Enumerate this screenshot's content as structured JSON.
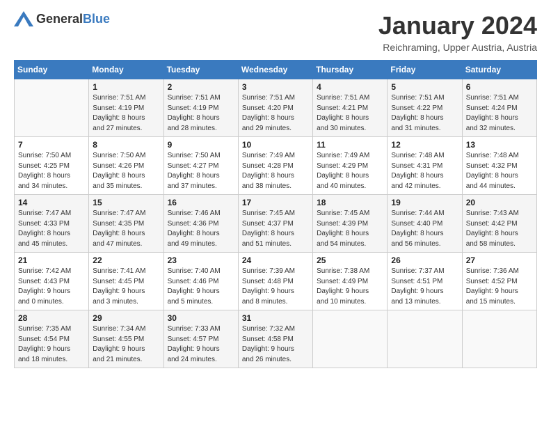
{
  "header": {
    "logo_general": "General",
    "logo_blue": "Blue",
    "month": "January 2024",
    "location": "Reichraming, Upper Austria, Austria"
  },
  "weekdays": [
    "Sunday",
    "Monday",
    "Tuesday",
    "Wednesday",
    "Thursday",
    "Friday",
    "Saturday"
  ],
  "weeks": [
    [
      {
        "day": "",
        "info": ""
      },
      {
        "day": "1",
        "info": "Sunrise: 7:51 AM\nSunset: 4:19 PM\nDaylight: 8 hours\nand 27 minutes."
      },
      {
        "day": "2",
        "info": "Sunrise: 7:51 AM\nSunset: 4:19 PM\nDaylight: 8 hours\nand 28 minutes."
      },
      {
        "day": "3",
        "info": "Sunrise: 7:51 AM\nSunset: 4:20 PM\nDaylight: 8 hours\nand 29 minutes."
      },
      {
        "day": "4",
        "info": "Sunrise: 7:51 AM\nSunset: 4:21 PM\nDaylight: 8 hours\nand 30 minutes."
      },
      {
        "day": "5",
        "info": "Sunrise: 7:51 AM\nSunset: 4:22 PM\nDaylight: 8 hours\nand 31 minutes."
      },
      {
        "day": "6",
        "info": "Sunrise: 7:51 AM\nSunset: 4:24 PM\nDaylight: 8 hours\nand 32 minutes."
      }
    ],
    [
      {
        "day": "7",
        "info": "Sunrise: 7:50 AM\nSunset: 4:25 PM\nDaylight: 8 hours\nand 34 minutes."
      },
      {
        "day": "8",
        "info": "Sunrise: 7:50 AM\nSunset: 4:26 PM\nDaylight: 8 hours\nand 35 minutes."
      },
      {
        "day": "9",
        "info": "Sunrise: 7:50 AM\nSunset: 4:27 PM\nDaylight: 8 hours\nand 37 minutes."
      },
      {
        "day": "10",
        "info": "Sunrise: 7:49 AM\nSunset: 4:28 PM\nDaylight: 8 hours\nand 38 minutes."
      },
      {
        "day": "11",
        "info": "Sunrise: 7:49 AM\nSunset: 4:29 PM\nDaylight: 8 hours\nand 40 minutes."
      },
      {
        "day": "12",
        "info": "Sunrise: 7:48 AM\nSunset: 4:31 PM\nDaylight: 8 hours\nand 42 minutes."
      },
      {
        "day": "13",
        "info": "Sunrise: 7:48 AM\nSunset: 4:32 PM\nDaylight: 8 hours\nand 44 minutes."
      }
    ],
    [
      {
        "day": "14",
        "info": "Sunrise: 7:47 AM\nSunset: 4:33 PM\nDaylight: 8 hours\nand 45 minutes."
      },
      {
        "day": "15",
        "info": "Sunrise: 7:47 AM\nSunset: 4:35 PM\nDaylight: 8 hours\nand 47 minutes."
      },
      {
        "day": "16",
        "info": "Sunrise: 7:46 AM\nSunset: 4:36 PM\nDaylight: 8 hours\nand 49 minutes."
      },
      {
        "day": "17",
        "info": "Sunrise: 7:45 AM\nSunset: 4:37 PM\nDaylight: 8 hours\nand 51 minutes."
      },
      {
        "day": "18",
        "info": "Sunrise: 7:45 AM\nSunset: 4:39 PM\nDaylight: 8 hours\nand 54 minutes."
      },
      {
        "day": "19",
        "info": "Sunrise: 7:44 AM\nSunset: 4:40 PM\nDaylight: 8 hours\nand 56 minutes."
      },
      {
        "day": "20",
        "info": "Sunrise: 7:43 AM\nSunset: 4:42 PM\nDaylight: 8 hours\nand 58 minutes."
      }
    ],
    [
      {
        "day": "21",
        "info": "Sunrise: 7:42 AM\nSunset: 4:43 PM\nDaylight: 9 hours\nand 0 minutes."
      },
      {
        "day": "22",
        "info": "Sunrise: 7:41 AM\nSunset: 4:45 PM\nDaylight: 9 hours\nand 3 minutes."
      },
      {
        "day": "23",
        "info": "Sunrise: 7:40 AM\nSunset: 4:46 PM\nDaylight: 9 hours\nand 5 minutes."
      },
      {
        "day": "24",
        "info": "Sunrise: 7:39 AM\nSunset: 4:48 PM\nDaylight: 9 hours\nand 8 minutes."
      },
      {
        "day": "25",
        "info": "Sunrise: 7:38 AM\nSunset: 4:49 PM\nDaylight: 9 hours\nand 10 minutes."
      },
      {
        "day": "26",
        "info": "Sunrise: 7:37 AM\nSunset: 4:51 PM\nDaylight: 9 hours\nand 13 minutes."
      },
      {
        "day": "27",
        "info": "Sunrise: 7:36 AM\nSunset: 4:52 PM\nDaylight: 9 hours\nand 15 minutes."
      }
    ],
    [
      {
        "day": "28",
        "info": "Sunrise: 7:35 AM\nSunset: 4:54 PM\nDaylight: 9 hours\nand 18 minutes."
      },
      {
        "day": "29",
        "info": "Sunrise: 7:34 AM\nSunset: 4:55 PM\nDaylight: 9 hours\nand 21 minutes."
      },
      {
        "day": "30",
        "info": "Sunrise: 7:33 AM\nSunset: 4:57 PM\nDaylight: 9 hours\nand 24 minutes."
      },
      {
        "day": "31",
        "info": "Sunrise: 7:32 AM\nSunset: 4:58 PM\nDaylight: 9 hours\nand 26 minutes."
      },
      {
        "day": "",
        "info": ""
      },
      {
        "day": "",
        "info": ""
      },
      {
        "day": "",
        "info": ""
      }
    ]
  ]
}
